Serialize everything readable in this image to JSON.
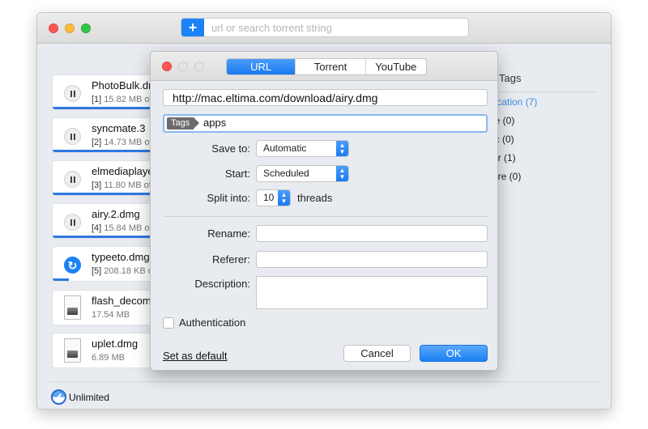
{
  "window": {
    "search": {
      "add_label": "+",
      "placeholder": "url or search torrent string"
    }
  },
  "downloads": [
    {
      "name": "PhotoBulk.dmg",
      "index": "[1]",
      "size": "15.82 MB of",
      "state": "downloading",
      "icon": "pause-icon",
      "progress": 1.0
    },
    {
      "name": "syncmate.3",
      "index": "[2]",
      "size": "14.73 MB of",
      "state": "downloading",
      "icon": "pause-icon",
      "progress": 1.0
    },
    {
      "name": "elmediaplayer",
      "index": "[3]",
      "size": "11.80 MB of",
      "state": "downloading",
      "icon": "pause-icon",
      "progress": 1.0
    },
    {
      "name": "airy.2.dmg",
      "index": "[4]",
      "size": "15.84 MB of",
      "state": "downloading",
      "icon": "pause-icon",
      "progress": 1.0
    },
    {
      "name": "typeeto.dmg",
      "index": "[5]",
      "size": "208.18 KB of",
      "state": "paused",
      "icon": "resume-icon",
      "progress": 0.15
    },
    {
      "name": "flash_decompiler",
      "index": "",
      "size": "17.54 MB",
      "state": "completed",
      "icon": "dmg-file-icon",
      "progress": 0
    },
    {
      "name": "uplet.dmg",
      "index": "",
      "size": "6.89 MB",
      "state": "completed",
      "icon": "dmg-file-icon",
      "progress": 0
    }
  ],
  "tags_panel": {
    "title": "Tags",
    "items": [
      {
        "label": "lication (7)",
        "active": true
      },
      {
        "label": "ie (0)",
        "active": false
      },
      {
        "label": "ic (0)",
        "active": false
      },
      {
        "label": "er (1)",
        "active": false
      },
      {
        "label": "ure (0)",
        "active": false
      }
    ]
  },
  "footer": {
    "speed_label": "Unlimited"
  },
  "dialog": {
    "tabs": [
      {
        "label": "URL",
        "active": true
      },
      {
        "label": "Torrent",
        "active": false
      },
      {
        "label": "YouTube",
        "active": false
      }
    ],
    "url_value": "http://mac.eltima.com/download/airy.dmg",
    "tags_chip": "Tags",
    "tags_value": "apps",
    "save_to_label": "Save to:",
    "save_to_value": "Automatic",
    "start_label": "Start:",
    "start_value": "Scheduled",
    "split_label": "Split into:",
    "split_value": "10",
    "threads_label": "threads",
    "rename_label": "Rename:",
    "rename_value": "",
    "referer_label": "Referer:",
    "referer_value": "",
    "description_label": "Description:",
    "description_value": "",
    "auth_label": "Authentication",
    "auth_checked": false,
    "set_default_label": "Set as default",
    "cancel_label": "Cancel",
    "ok_label": "OK"
  },
  "colors": {
    "accent": "#1b82f7",
    "progress": "#2f78e0",
    "tag_active": "#3a8ee6"
  }
}
